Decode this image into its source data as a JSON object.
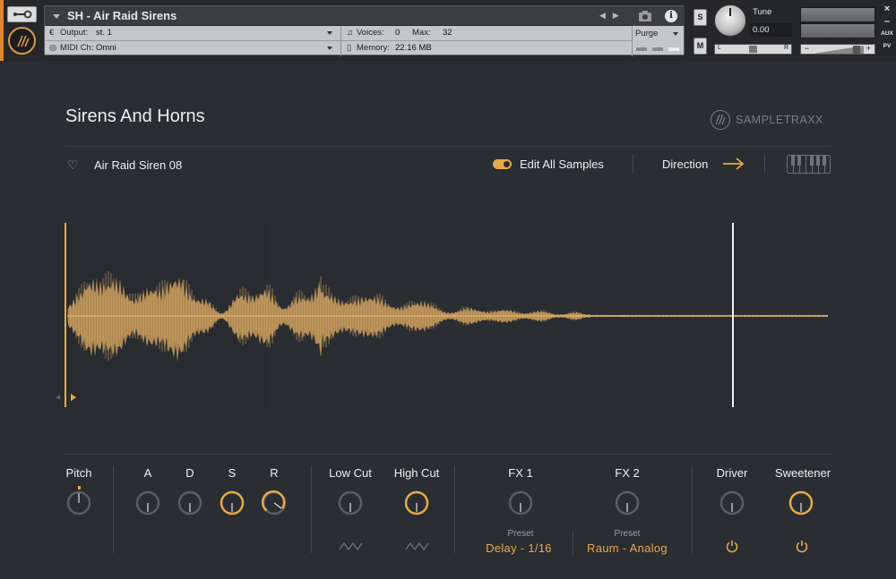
{
  "kontakt": {
    "instrument_name": "SH - Air Raid Sirens",
    "output_label": "Output:",
    "output_value": "st. 1",
    "midi_label": "MIDI Ch:",
    "midi_value": "Omni",
    "voices_label": "Voices:",
    "voices_value": "0",
    "max_label": "Max:",
    "max_value": "32",
    "memory_label": "Memory:",
    "memory_value": "22.16 MB",
    "purge_label": "Purge",
    "solo_label": "S",
    "mute_label": "M",
    "tune_label": "Tune",
    "tune_value": "0.00",
    "pan_left": "L",
    "pan_right": "R",
    "vol_minus": "−",
    "vol_plus": "+",
    "side_buttons": [
      "×",
      "–",
      "AUX",
      "PV"
    ],
    "icons": {
      "wrench": "wrench-icon",
      "camera": "camera-icon",
      "info": "info-icon"
    }
  },
  "main": {
    "title": "Sirens And Horns",
    "brand": "SAMPLETRAXX",
    "sample_name": "Air Raid Siren 08",
    "edit_all_label": "Edit All Samples",
    "edit_all_on": true,
    "direction_label": "Direction"
  },
  "controls": {
    "pitch": "Pitch",
    "a": "A",
    "d": "D",
    "s": "S",
    "r": "R",
    "low_cut": "Low Cut",
    "high_cut": "High Cut",
    "fx1": "FX 1",
    "fx2": "FX 2",
    "driver": "Driver",
    "sweetener": "Sweetener",
    "preset_label": "Preset",
    "fx1_preset": "Delay - 1/16",
    "fx2_preset": "Raum - Analog"
  },
  "colors": {
    "accent": "#e8a94a",
    "background": "#2a2d31",
    "knob_off": "#5b5f64",
    "text": "#eef0f2"
  }
}
